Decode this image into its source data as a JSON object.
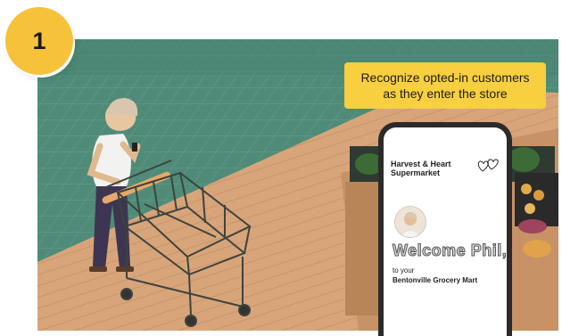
{
  "step": {
    "number": "1"
  },
  "callout": {
    "line1": "Recognize opted-in customers",
    "line2": "as they enter the store"
  },
  "phone": {
    "brand_line1": "Harvest & Heart",
    "brand_line2": "Supermarket",
    "greeting": "Welcome Phil,",
    "subtext": "to your",
    "store_name": "Bentonville Grocery Mart"
  },
  "colors": {
    "accent_yellow": "#f7cf3f",
    "badge_yellow": "#f5c23a",
    "floor_green": "#4f8b78",
    "floor_wood": "#d9a87c"
  },
  "icons": [
    "hearts-logo-icon"
  ]
}
